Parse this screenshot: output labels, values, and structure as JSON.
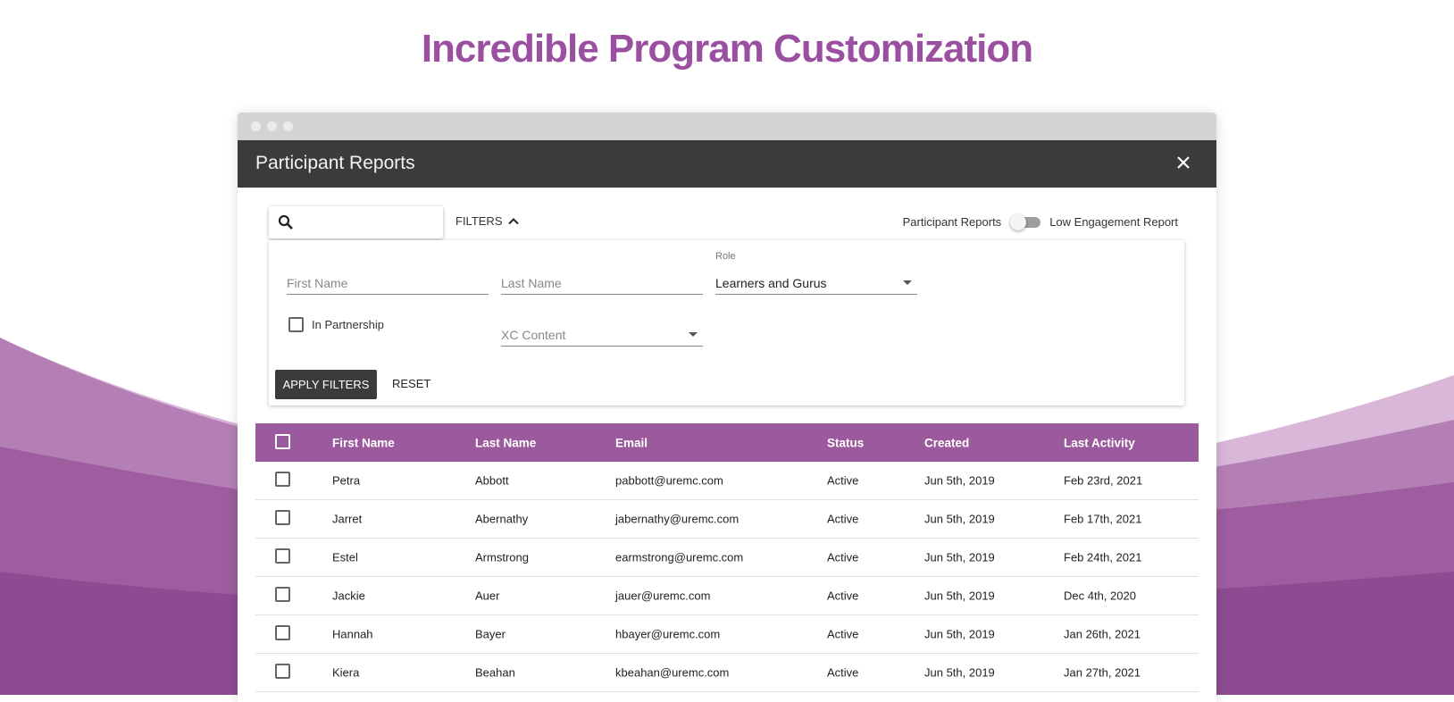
{
  "page": {
    "headline": "Incredible Program Customization"
  },
  "colors": {
    "brand_purple": "#9b4fa1",
    "header_purple": "#9c5a9e",
    "dark_bar": "#3b3b3d"
  },
  "window": {
    "title": "Participant Reports",
    "close_icon": "close-icon"
  },
  "toolbar": {
    "search_placeholder": "",
    "filters_label": "FILTERS",
    "toggle_left_label": "Participant Reports",
    "toggle_right_label": "Low Engagement Report"
  },
  "filters": {
    "first_name_placeholder": "First Name",
    "last_name_placeholder": "Last Name",
    "role_label": "Role",
    "role_value": "Learners and Gurus",
    "partnership_label": "In Partnership",
    "xc_content_placeholder": "XC Content",
    "apply_label": "APPLY FILTERS",
    "reset_label": "RESET"
  },
  "table": {
    "headers": [
      "First Name",
      "Last Name",
      "Email",
      "Status",
      "Created",
      "Last Activity"
    ],
    "rows": [
      [
        "Petra",
        "Abbott",
        "pabbott@uremc.com",
        "Active",
        "Jun 5th, 2019",
        "Feb 23rd, 2021"
      ],
      [
        "Jarret",
        "Abernathy",
        "jabernathy@uremc.com",
        "Active",
        "Jun 5th, 2019",
        "Feb 17th, 2021"
      ],
      [
        "Estel",
        "Armstrong",
        "earmstrong@uremc.com",
        "Active",
        "Jun 5th, 2019",
        "Feb 24th, 2021"
      ],
      [
        "Jackie",
        "Auer",
        "jauer@uremc.com",
        "Active",
        "Jun 5th, 2019",
        "Dec 4th, 2020"
      ],
      [
        "Hannah",
        "Bayer",
        "hbayer@uremc.com",
        "Active",
        "Jun 5th, 2019",
        "Jan 26th, 2021"
      ],
      [
        "Kiera",
        "Beahan",
        "kbeahan@uremc.com",
        "Active",
        "Jun 5th, 2019",
        "Jan 27th, 2021"
      ]
    ]
  }
}
